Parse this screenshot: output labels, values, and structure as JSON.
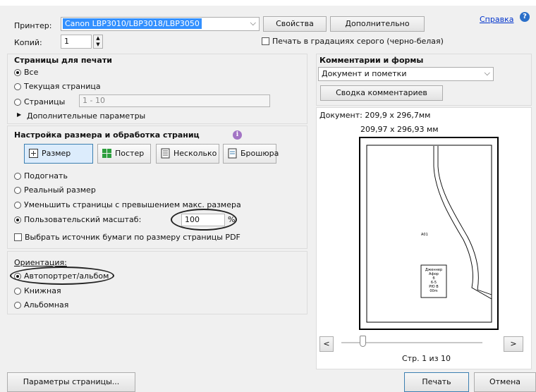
{
  "printer": {
    "label": "Принтер:",
    "selected": "Canon LBP3010/LBP3018/LBP3050",
    "properties_button": "Свойства",
    "advanced_button": "Дополнительно",
    "help_link": "Справка"
  },
  "copies": {
    "label": "Копий:",
    "value": "1",
    "grayscale_label": "Печать в градациях серого (черно-белая)",
    "grayscale_checked": false
  },
  "pages": {
    "title": "Страницы для печати",
    "all": "Все",
    "current": "Текущая страница",
    "range_label": "Страницы",
    "range_value": "1 - 10",
    "more_options": "Дополнительные параметры",
    "selected": "all"
  },
  "sizing": {
    "title": "Настройка размера и обработка страниц",
    "modes": [
      "Размер",
      "Постер",
      "Несколько",
      "Брошюра"
    ],
    "active_mode": "Размер",
    "fit": "Подогнать",
    "actual": "Реальный размер",
    "shrink": "Уменьшить страницы с превышением макс. размера",
    "custom": "Пользовательский масштаб:",
    "custom_value": "100",
    "custom_unit": "%",
    "paper_source": "Выбрать источник бумаги по размеру страницы PDF",
    "selected": "custom"
  },
  "orientation": {
    "title": "Ориентация:",
    "auto": "Автопортрет/альбом",
    "portrait": "Книжная",
    "landscape": "Альбомная",
    "selected": "auto"
  },
  "comments": {
    "title": "Комментарии и формы",
    "selected": "Документ и пометки",
    "summary_button": "Сводка комментариев"
  },
  "preview": {
    "document_size": "Документ: 209,9 x 296,7мм",
    "page_size": "209,97 x 296,93 мм",
    "prev_button": "<",
    "next_button": ">",
    "page_counter": "Стр. 1 из 10",
    "sheet_label": "A01",
    "sheet_stamp": "Дженнер Афор\nб\n6-5\nРЮ В\n00m"
  },
  "footer": {
    "page_setup_button": "Параметры страницы...",
    "print_button": "Печать",
    "cancel_button": "Отмена"
  }
}
